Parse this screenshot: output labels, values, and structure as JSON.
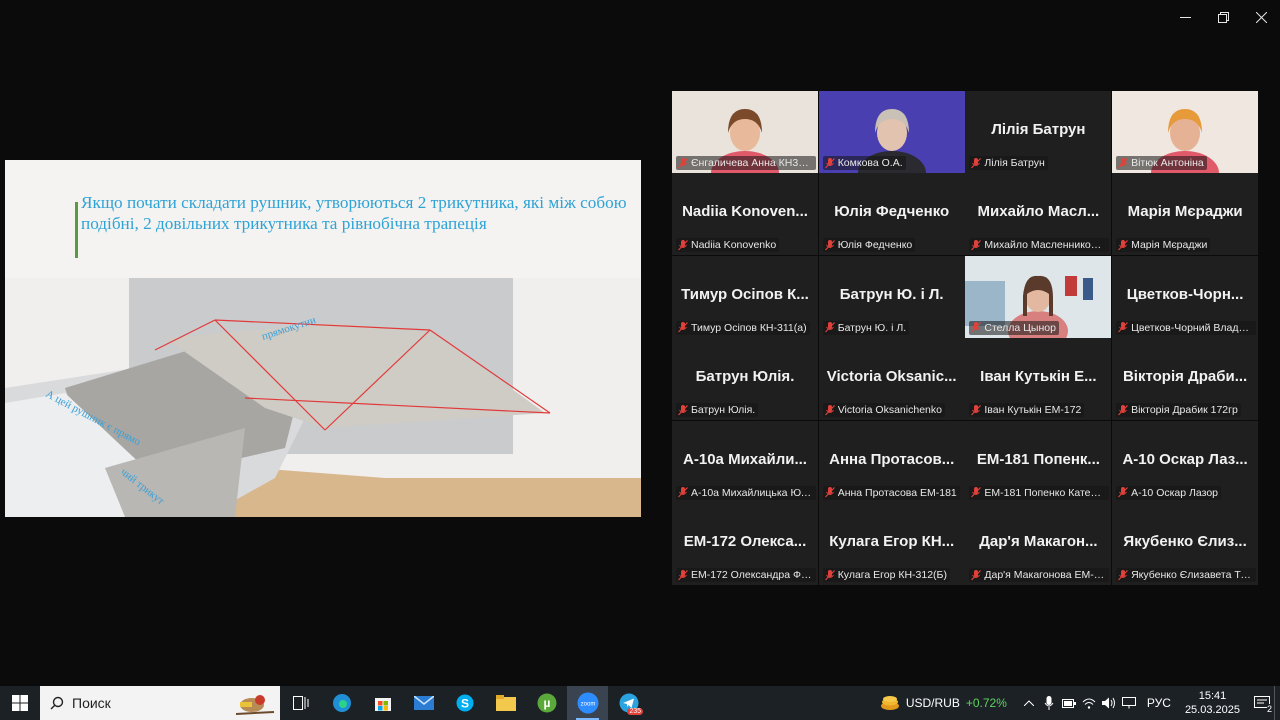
{
  "slide": {
    "title": "Якщо почати складати рушник, утворюються 2 трикутника, які між собою подібні, 2 довільних трикутника та рівнобічна трапеція",
    "paper_text_1": "А цей рушник є прямо",
    "paper_text_2": "прямокутни",
    "paper_text_3": "чий трикут"
  },
  "participants": [
    {
      "display": "",
      "label": "Єнгаличева Анна КН311А",
      "video": true
    },
    {
      "display": "",
      "label": "Комкова О.А.",
      "video": true
    },
    {
      "display": "Лілія Батрун",
      "label": "Лілія Батрун",
      "video": false
    },
    {
      "display": "",
      "label": "Вітюк Антоніна",
      "video": true
    },
    {
      "display": "Nadiia Konoven...",
      "label": "Nadiia Konovenko",
      "video": false
    },
    {
      "display": "Юлія Федченко",
      "label": "Юлія Федченко",
      "video": false
    },
    {
      "display": "Михайло Масл...",
      "label": "Михайло Масленников 3Т...",
      "video": false
    },
    {
      "display": "Марія Мєраджи",
      "label": "Марія Мєраджи",
      "video": false
    },
    {
      "display": "Тимур Осіпов К...",
      "label": "Тимур Осіпов КН-311(а)",
      "video": false
    },
    {
      "display": "Батрун Ю. і Л.",
      "label": "Батрун Ю. і Л.",
      "video": false
    },
    {
      "display": "",
      "label": "Стелла Цынор",
      "video": true,
      "active": true
    },
    {
      "display": "Цветков-Чорн...",
      "label": "Цветков-Чорний Владис...",
      "video": false
    },
    {
      "display": "Батрун Юлія.",
      "label": "Батрун Юлія.",
      "video": false
    },
    {
      "display": "Victoria Oksanic...",
      "label": "Victoria Oksanichenko",
      "video": false
    },
    {
      "display": "Іван Кутькін Е...",
      "label": "Іван Кутькін ЕМ-172",
      "video": false
    },
    {
      "display": "Вікторія Драби...",
      "label": "Вікторія Драбик 172гр",
      "video": false
    },
    {
      "display": "А-10а Михайли...",
      "label": "А-10а Михайлицька Юлія",
      "video": false
    },
    {
      "display": "Анна Протасов...",
      "label": "Анна Протасова ЕМ-181",
      "video": false
    },
    {
      "display": "ЕМ-181 Попенк...",
      "label": "ЕМ-181 Попенко Катери...",
      "video": false
    },
    {
      "display": "А-10 Оскар Лаз...",
      "label": "А-10 Оскар Лазор",
      "video": false
    },
    {
      "display": "ЕМ-172 Олекса...",
      "label": "ЕМ-172 Олександра Фуз...",
      "video": false
    },
    {
      "display": "Кулага Егор КН...",
      "label": "Кулага Егор КН-312(Б)",
      "video": false
    },
    {
      "display": "Дар'я Макагон...",
      "label": "Дар'я Макагонова ЕМ-1...",
      "video": false
    },
    {
      "display": "Якубенко Єлиз...",
      "label": "Якубенко Єлизавета Тх-1...",
      "video": false
    }
  ],
  "taskbar": {
    "search_placeholder": "Поиск",
    "ticker_pair": "USD/RUB",
    "ticker_change": "+0.72%",
    "language": "РУС",
    "time": "15:41",
    "date": "25.03.2025",
    "telegram_badge": "235",
    "notifications": "2",
    "zoom_label": "zoom"
  },
  "colors": {
    "active_speaker": "#2ecc71",
    "muted_mic": "#e0413a",
    "slide_title": "#2ea3d6",
    "ticker_up": "#5fd35f"
  }
}
